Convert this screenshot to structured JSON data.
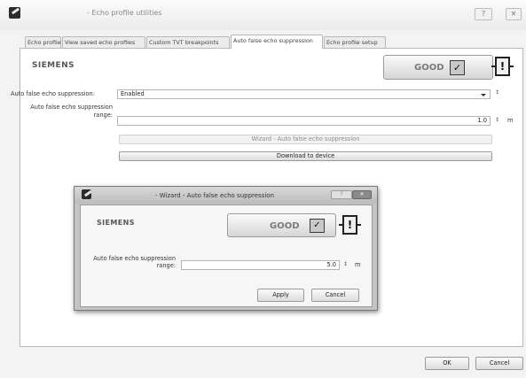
{
  "window": {
    "title": "- Echo profile utilities",
    "help_glyph": "?",
    "close_glyph": "✕"
  },
  "tabs": [
    {
      "label": "Echo profile"
    },
    {
      "label": "View saved echo profiles"
    },
    {
      "label": "Custom TVT breakpoints"
    },
    {
      "label": "Auto false echo suppression"
    },
    {
      "label": "Echo profile setup"
    }
  ],
  "active_tab": "Auto false echo suppression",
  "brand": "SIEMENS",
  "status": {
    "text": "GOOD",
    "check_glyph": "✓",
    "warn_glyph": "!"
  },
  "form": {
    "afes_label": "Auto false echo suppression:",
    "afes_value": "Enabled",
    "range_label_line1": "Auto false echo suppression",
    "range_label_line2": "range:",
    "range_value": "1.0",
    "range_unit": "m",
    "spin_glyph": "↕",
    "wizard_button": "Wizard - Auto false echo suppression",
    "download_button": "Download to device"
  },
  "dialog": {
    "title": "- Wizard - Auto false echo suppression",
    "help_glyph": "?",
    "close_glyph": "✕",
    "brand": "SIEMENS",
    "status_text": "GOOD",
    "range_label_line1": "Auto false echo suppression",
    "range_label_line2": "range:",
    "range_value": "5.0",
    "range_unit": "m",
    "apply_button": "Apply",
    "cancel_button": "Cancel"
  },
  "footer": {
    "ok_button": "OK",
    "cancel_button": "Cancel"
  },
  "colors": {
    "window_bg": "#f3f3f3",
    "panel_bg": "#ffffff",
    "dialog_frame": "#c4c4c4",
    "accent_dark": "#222222"
  }
}
